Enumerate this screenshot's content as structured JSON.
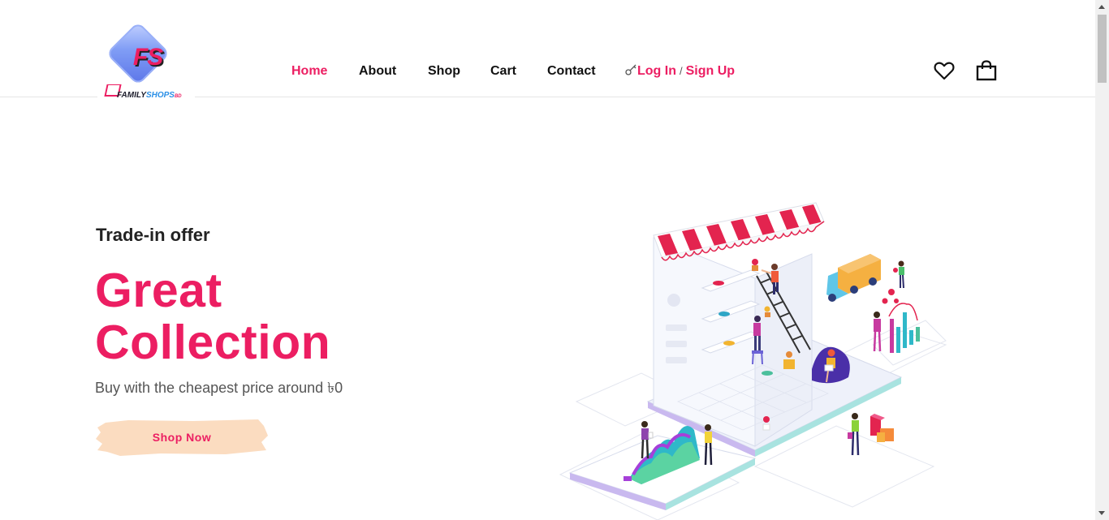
{
  "brand": {
    "logo_letters": "FS",
    "logo_word_family": "FAMILY",
    "logo_word_shops": "SHOPS",
    "logo_word_bd": "BD"
  },
  "nav": {
    "items": [
      {
        "label": "Home",
        "active": true
      },
      {
        "label": "About",
        "active": false
      },
      {
        "label": "Shop",
        "active": false
      },
      {
        "label": "Cart",
        "active": false
      },
      {
        "label": "Contact",
        "active": false
      }
    ],
    "login_label": "Log In",
    "separator": "/",
    "signup_label": "Sign Up"
  },
  "header_icons": {
    "wishlist": "heart-icon",
    "bag": "shopping-bag-icon"
  },
  "hero": {
    "subtitle": "Trade-in offer",
    "title_line1": "Great",
    "title_line2": "Collection",
    "description": "Buy with the cheapest price around ৳0",
    "cta_label": "Shop Now"
  },
  "colors": {
    "accent": "#ec1e62",
    "cta_brush": "#fbdcc0",
    "text_dark": "#1a1a1a"
  }
}
